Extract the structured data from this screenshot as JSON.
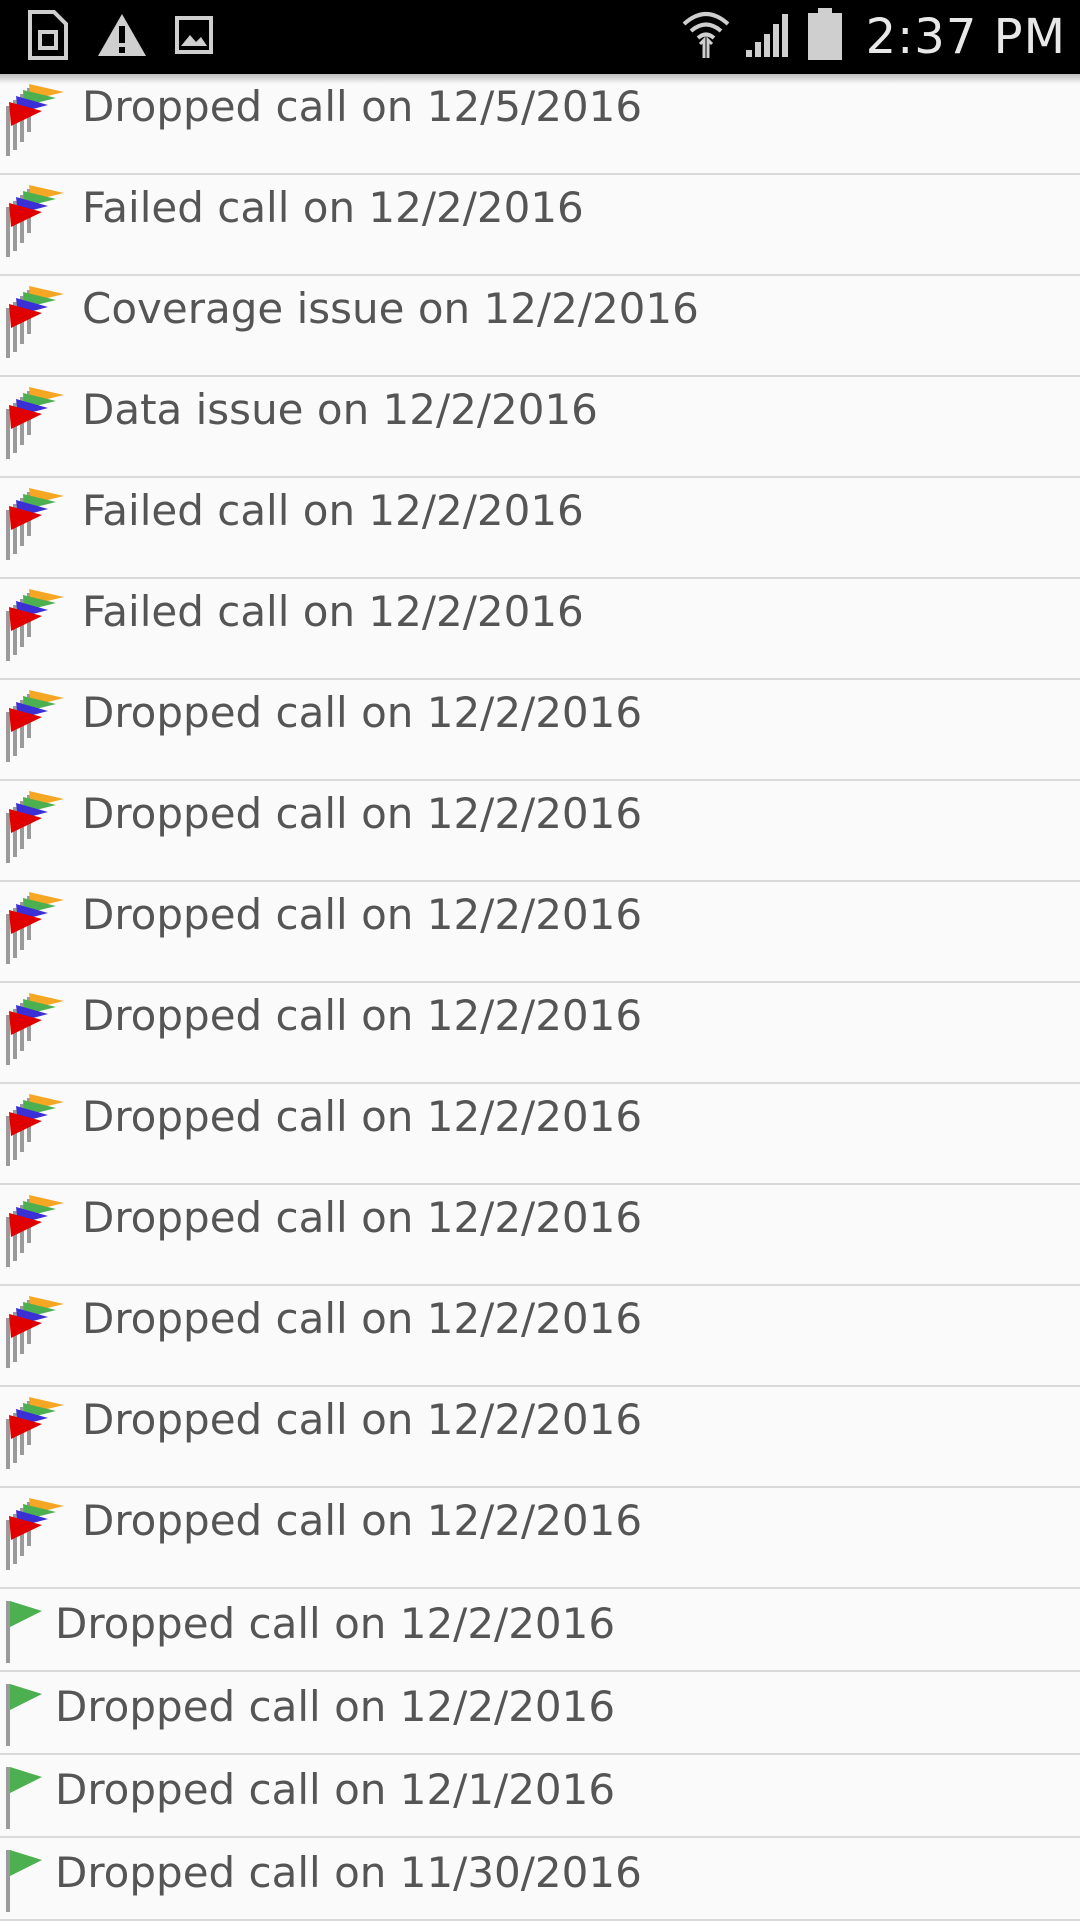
{
  "status_bar": {
    "time": "2:37 PM",
    "icons_left": [
      "sim-card-icon",
      "warning-icon",
      "image-icon"
    ],
    "icons_right": [
      "wifi-icon",
      "signal-icon",
      "battery-icon"
    ]
  },
  "colors": {
    "flag_red": "#e00000",
    "flag_blue": "#3b2fd6",
    "flag_green": "#4caf50",
    "flag_orange": "#f5a623",
    "pole_gray": "#9a9a9a"
  },
  "items": [
    {
      "label": "Dropped call on 12/5/2016",
      "icon": "multi-flag-icon"
    },
    {
      "label": "Failed call on 12/2/2016",
      "icon": "multi-flag-icon"
    },
    {
      "label": "Coverage issue on 12/2/2016",
      "icon": "multi-flag-icon"
    },
    {
      "label": "Data issue on 12/2/2016",
      "icon": "multi-flag-icon"
    },
    {
      "label": "Failed call on 12/2/2016",
      "icon": "multi-flag-icon"
    },
    {
      "label": "Failed call on 12/2/2016",
      "icon": "multi-flag-icon"
    },
    {
      "label": "Dropped call on 12/2/2016",
      "icon": "multi-flag-icon"
    },
    {
      "label": "Dropped call on 12/2/2016",
      "icon": "multi-flag-icon"
    },
    {
      "label": "Dropped call on 12/2/2016",
      "icon": "multi-flag-icon"
    },
    {
      "label": "Dropped call on 12/2/2016",
      "icon": "multi-flag-icon"
    },
    {
      "label": "Dropped call on 12/2/2016",
      "icon": "multi-flag-icon"
    },
    {
      "label": "Dropped call on 12/2/2016",
      "icon": "multi-flag-icon"
    },
    {
      "label": "Dropped call on 12/2/2016",
      "icon": "multi-flag-icon"
    },
    {
      "label": "Dropped call on 12/2/2016",
      "icon": "multi-flag-icon"
    },
    {
      "label": "Dropped call on 12/2/2016",
      "icon": "multi-flag-icon"
    },
    {
      "label": "Dropped call on 12/2/2016",
      "icon": "green-flag-icon"
    },
    {
      "label": "Dropped call on 12/2/2016",
      "icon": "green-flag-icon"
    },
    {
      "label": "Dropped call on 12/1/2016",
      "icon": "green-flag-icon"
    },
    {
      "label": "Dropped call on 11/30/2016",
      "icon": "green-flag-icon"
    }
  ]
}
